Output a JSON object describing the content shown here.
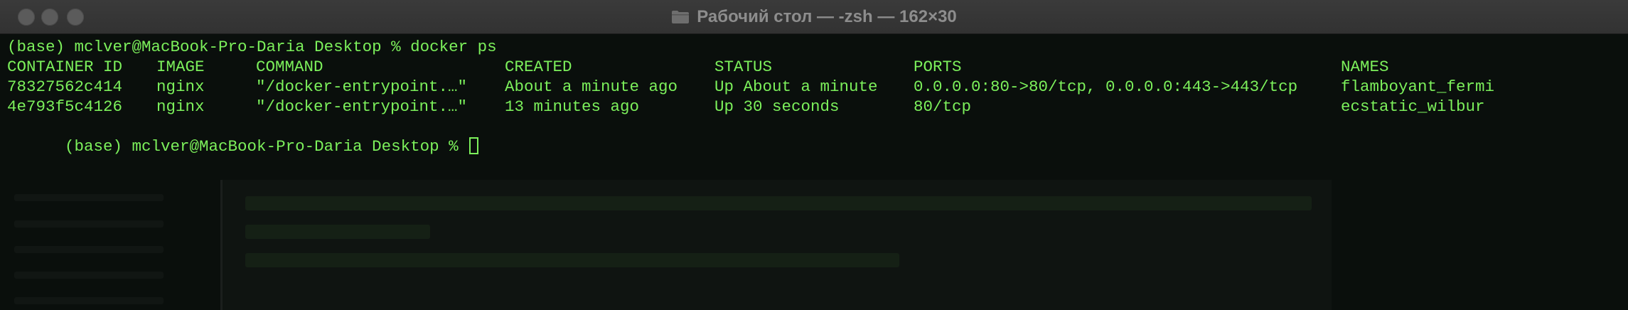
{
  "window": {
    "title": "Рабочий стол — -zsh — 162×30",
    "title_icon": "folder-icon",
    "accent_text_color": "#7cf05b"
  },
  "terminal": {
    "prompt_line_1": "(base) mclver@MacBook-Pro-Daria Desktop % docker ps",
    "headers": {
      "container_id": "CONTAINER ID",
      "image": "IMAGE",
      "command": "COMMAND",
      "created": "CREATED",
      "status": "STATUS",
      "ports": "PORTS",
      "names": "NAMES"
    },
    "rows": [
      {
        "container_id": "78327562c414",
        "image": "nginx",
        "command": "\"/docker-entrypoint.…\"",
        "created": "About a minute ago",
        "status": "Up About a minute",
        "ports": "0.0.0.0:80->80/tcp, 0.0.0.0:443->443/tcp",
        "names": "flamboyant_fermi"
      },
      {
        "container_id": "4e793f5c4126",
        "image": "nginx",
        "command": "\"/docker-entrypoint.…\"",
        "created": "13 minutes ago",
        "status": "Up 30 seconds",
        "ports": "80/tcp",
        "names": "ecstatic_wilbur"
      }
    ],
    "prompt_line_2": "(base) mclver@MacBook-Pro-Daria Desktop % "
  }
}
